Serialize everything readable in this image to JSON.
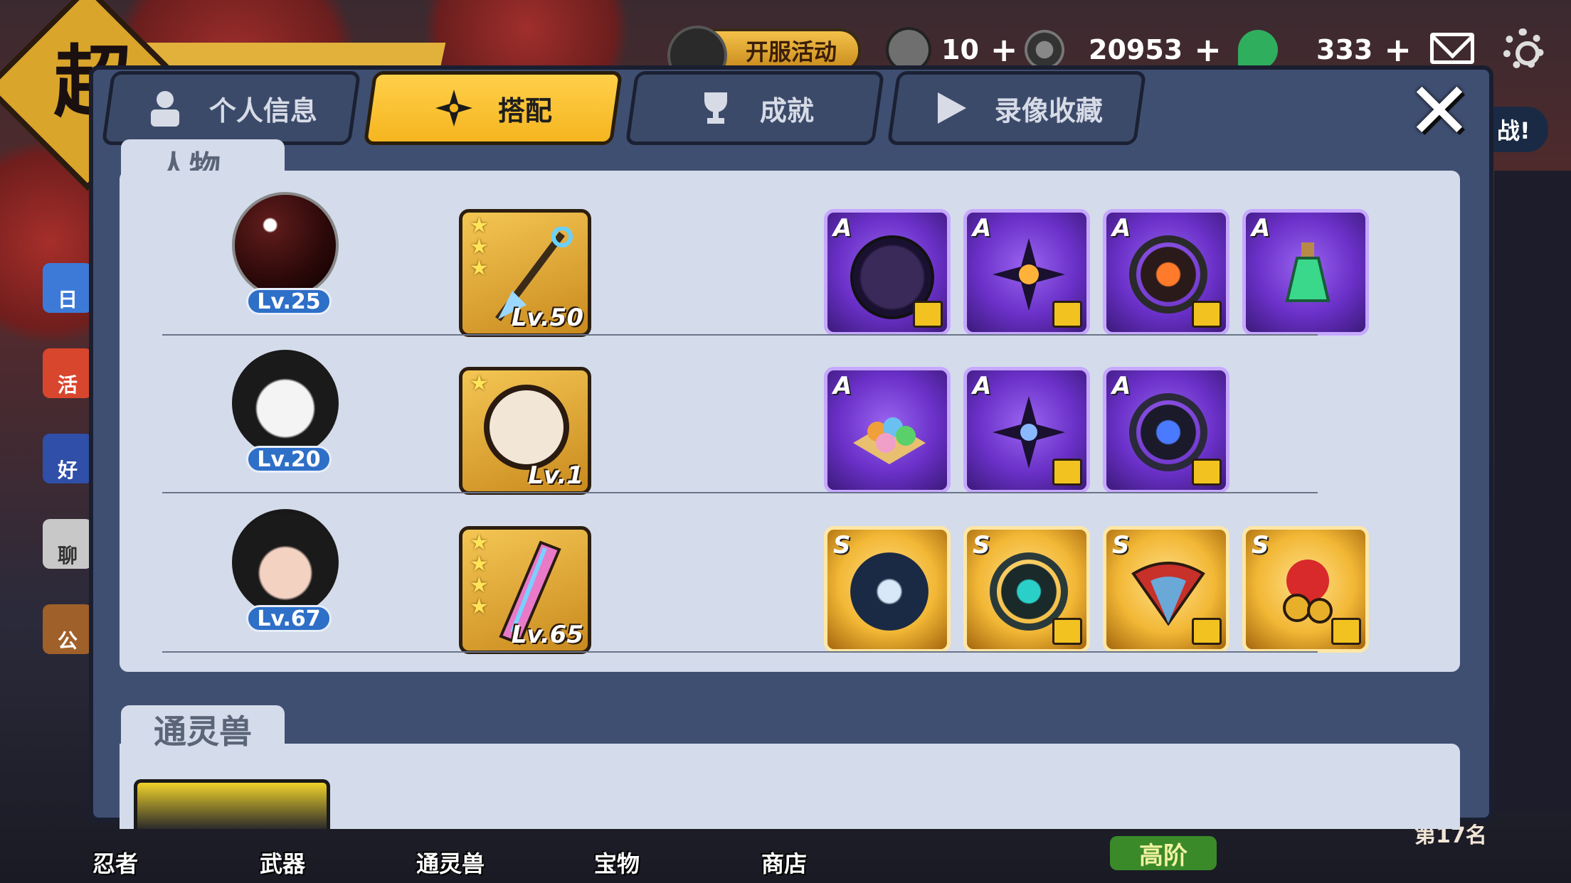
{
  "top": {
    "event_label": "开服活动",
    "currencies": [
      {
        "name": "scroll-currency",
        "value": "10",
        "color": "#7a7a7a"
      },
      {
        "name": "coin-currency",
        "value": "20953",
        "color": "#555555"
      },
      {
        "name": "jade-currency",
        "value": "333",
        "color": "#2fae5e"
      }
    ],
    "plus_symbol": "+"
  },
  "background": {
    "big_char": "超",
    "left_labels": [
      "日",
      "活",
      "好",
      "聊",
      "公"
    ],
    "side_text": "战!",
    "advanced_badge": "高阶",
    "rank_text": "第17名"
  },
  "tabs": [
    {
      "label": "个人信息",
      "icon": "profile-icon",
      "active": false
    },
    {
      "label": "搭配",
      "icon": "shuriken-icon",
      "active": true
    },
    {
      "label": "成就",
      "icon": "trophy-icon",
      "active": false
    },
    {
      "label": "录像收藏",
      "icon": "play-icon",
      "active": false
    }
  ],
  "close_label": "✕",
  "section1": {
    "label": "人物",
    "rows": [
      {
        "level": "Lv.25",
        "avatar_color": "#2a0a0a",
        "weapon": {
          "level": "Lv.50",
          "stars": 3
        },
        "items": [
          {
            "grade": "A",
            "tier": "A",
            "icon": "daruma-icon"
          },
          {
            "grade": "A",
            "tier": "A",
            "icon": "shuriken-fire-icon"
          },
          {
            "grade": "A",
            "tier": "A",
            "icon": "fire-ring-icon"
          },
          {
            "grade": "A",
            "tier": "A",
            "icon": "potion-icon"
          }
        ]
      },
      {
        "level": "Lv.20",
        "avatar_color": "#f2f2f2",
        "weapon": {
          "level": "Lv.1",
          "stars": 1
        },
        "items": [
          {
            "grade": "A",
            "tier": "A",
            "icon": "dango-icon"
          },
          {
            "grade": "A",
            "tier": "A",
            "icon": "shuriken-lightning-icon"
          },
          {
            "grade": "A",
            "tier": "A",
            "icon": "lightning-ring-icon"
          }
        ]
      },
      {
        "level": "Lv.67",
        "avatar_color": "#1a1a1a",
        "weapon": {
          "level": "Lv.65",
          "stars": 4
        },
        "items": [
          {
            "grade": "S",
            "tier": "S",
            "icon": "dark-cloak-icon"
          },
          {
            "grade": "S",
            "tier": "S",
            "icon": "water-ring-icon"
          },
          {
            "grade": "S",
            "tier": "S",
            "icon": "fan-icon"
          },
          {
            "grade": "S",
            "tier": "S",
            "icon": "bell-icon"
          }
        ]
      }
    ]
  },
  "section2": {
    "label": "通灵兽"
  },
  "bottom_nav": [
    "忍者",
    "武器",
    "通灵兽",
    "宝物",
    "商店"
  ]
}
